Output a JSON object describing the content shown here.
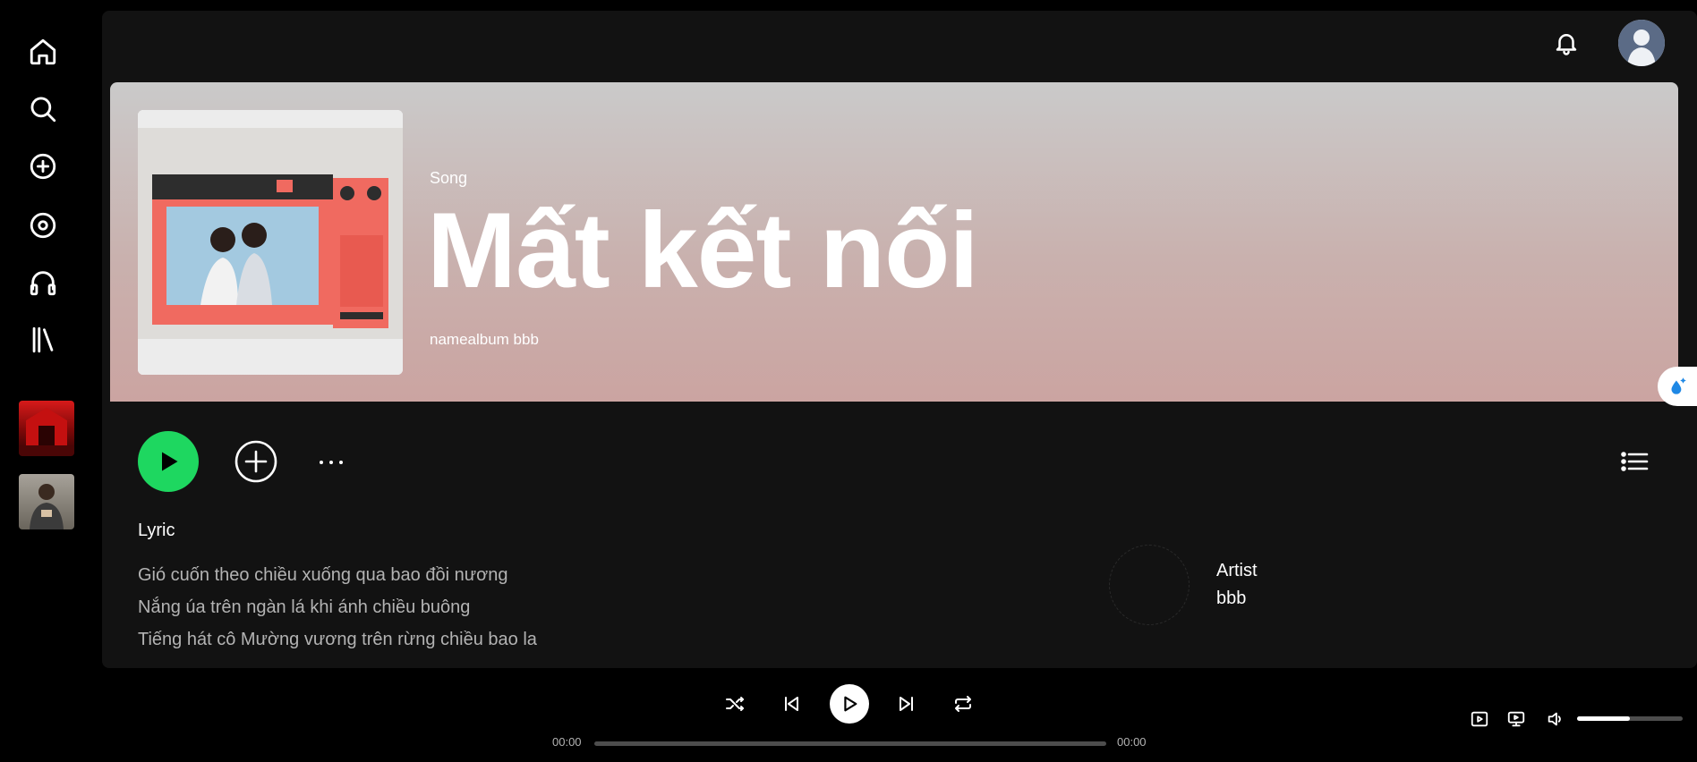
{
  "sidebar": {
    "nav": [
      {
        "name": "home",
        "icon": "home-icon"
      },
      {
        "name": "search",
        "icon": "search-icon"
      },
      {
        "name": "create",
        "icon": "plus-circle-icon"
      },
      {
        "name": "albums",
        "icon": "disc-icon"
      },
      {
        "name": "podcasts",
        "icon": "headphones-icon"
      },
      {
        "name": "library",
        "icon": "library-icon"
      }
    ],
    "library_items": [
      {
        "name": "library-item-red-cover",
        "color": "#b01818"
      },
      {
        "name": "library-item-artist-photo",
        "color": "#6d6a62"
      }
    ]
  },
  "header": {
    "notifications_icon": "bell-icon",
    "avatar_icon": "user-avatar-icon"
  },
  "song": {
    "type_label": "Song",
    "title": "Mất kết nối",
    "meta": "namealbum bbb",
    "hero_gradient": [
      "#cacaca",
      "#cba4a1"
    ]
  },
  "actions": {
    "play_icon": "play-icon",
    "add_icon": "plus-circle-icon",
    "more_icon": "more-dots-icon",
    "list_icon": "list-icon",
    "play_color": "#1ed760"
  },
  "lyrics": {
    "title": "Lyric",
    "lines": [
      "Gió cuốn theo chiều xuống qua bao đồi nương",
      "Nắng úa trên ngàn lá khi ánh chiều buông",
      "Tiếng hát cô Mường vương trên rừng chiều bao la"
    ]
  },
  "artist": {
    "label": "Artist",
    "name": "bbb"
  },
  "player": {
    "current_time": "00:00",
    "total_time": "00:00",
    "progress": 0,
    "volume": 0.5
  }
}
